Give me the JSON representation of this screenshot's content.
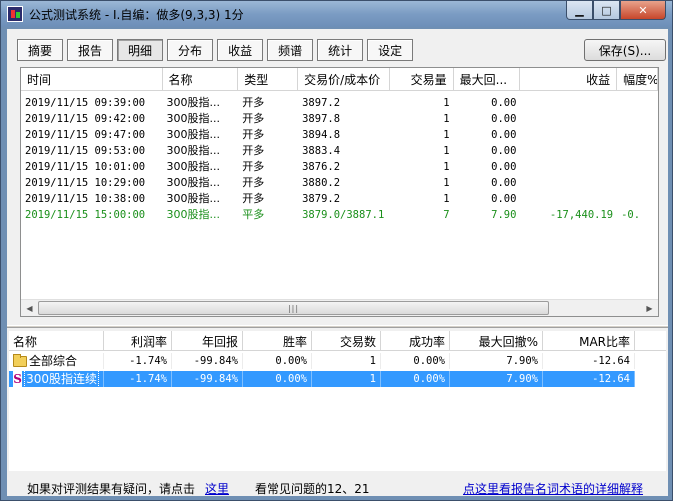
{
  "window": {
    "title": "公式测试系统 - I.自编：做多(9,3,3) 1分",
    "minimize_glyph": "▁",
    "maximize_glyph": "□",
    "close_glyph": "✕"
  },
  "tabs": [
    {
      "label": "摘要",
      "active": false
    },
    {
      "label": "报告",
      "active": false
    },
    {
      "label": "明细",
      "active": true
    },
    {
      "label": "分布",
      "active": false
    },
    {
      "label": "收益",
      "active": false
    },
    {
      "label": "频谱",
      "active": false
    },
    {
      "label": "统计",
      "active": false
    },
    {
      "label": "设定",
      "active": false
    }
  ],
  "save_button": "保存(S)...",
  "detail": {
    "columns": [
      "时间",
      "名称",
      "类型",
      "交易价/成本价",
      "交易量",
      "最大回...",
      "收益",
      "幅度%"
    ],
    "rows": [
      [
        "2019/11/15 09:39:00",
        "300股指...",
        "开多",
        "3897.2",
        "1",
        "0.00",
        "",
        ""
      ],
      [
        "2019/11/15 09:42:00",
        "300股指...",
        "开多",
        "3897.8",
        "1",
        "0.00",
        "",
        ""
      ],
      [
        "2019/11/15 09:47:00",
        "300股指...",
        "开多",
        "3894.8",
        "1",
        "0.00",
        "",
        ""
      ],
      [
        "2019/11/15 09:53:00",
        "300股指...",
        "开多",
        "3883.4",
        "1",
        "0.00",
        "",
        ""
      ],
      [
        "2019/11/15 10:01:00",
        "300股指...",
        "开多",
        "3876.2",
        "1",
        "0.00",
        "",
        ""
      ],
      [
        "2019/11/15 10:29:00",
        "300股指...",
        "开多",
        "3880.2",
        "1",
        "0.00",
        "",
        ""
      ],
      [
        "2019/11/15 10:38:00",
        "300股指...",
        "开多",
        "3879.2",
        "1",
        "0.00",
        "",
        ""
      ],
      [
        "2019/11/15 15:00:00",
        "300股指...",
        "平多",
        "3879.0/3887.1",
        "7",
        "7.90",
        "-17,440.19",
        "-0."
      ]
    ],
    "highlight_row_color": "#1a8f1a"
  },
  "summary": {
    "columns": [
      "名称",
      "利润率",
      "年回报",
      "胜率",
      "交易数",
      "成功率",
      "最大回撤%",
      "MAR比率"
    ],
    "rows": [
      {
        "icon": "folder-icon",
        "name": "全部综合",
        "values": [
          "-1.74%",
          "-99.84%",
          "0.00%",
          "1",
          "0.00%",
          "7.90%",
          "-12.64"
        ],
        "selected": false
      },
      {
        "icon": "s-icon",
        "icon_glyph": "S",
        "name": "300股指连续",
        "values": [
          "-1.74%",
          "-99.84%",
          "0.00%",
          "1",
          "0.00%",
          "7.90%",
          "-12.64"
        ],
        "selected": true
      }
    ]
  },
  "footer": {
    "prefix": "如果对评测结果有疑问，请点击",
    "link1": "这里",
    "suffix": "看常见问题的12、21",
    "link2": "点这里看报告名词术语的详细解释"
  },
  "scrollbar": {
    "left_arrow": "◀",
    "right_arrow": "▶",
    "grip": "|||"
  }
}
